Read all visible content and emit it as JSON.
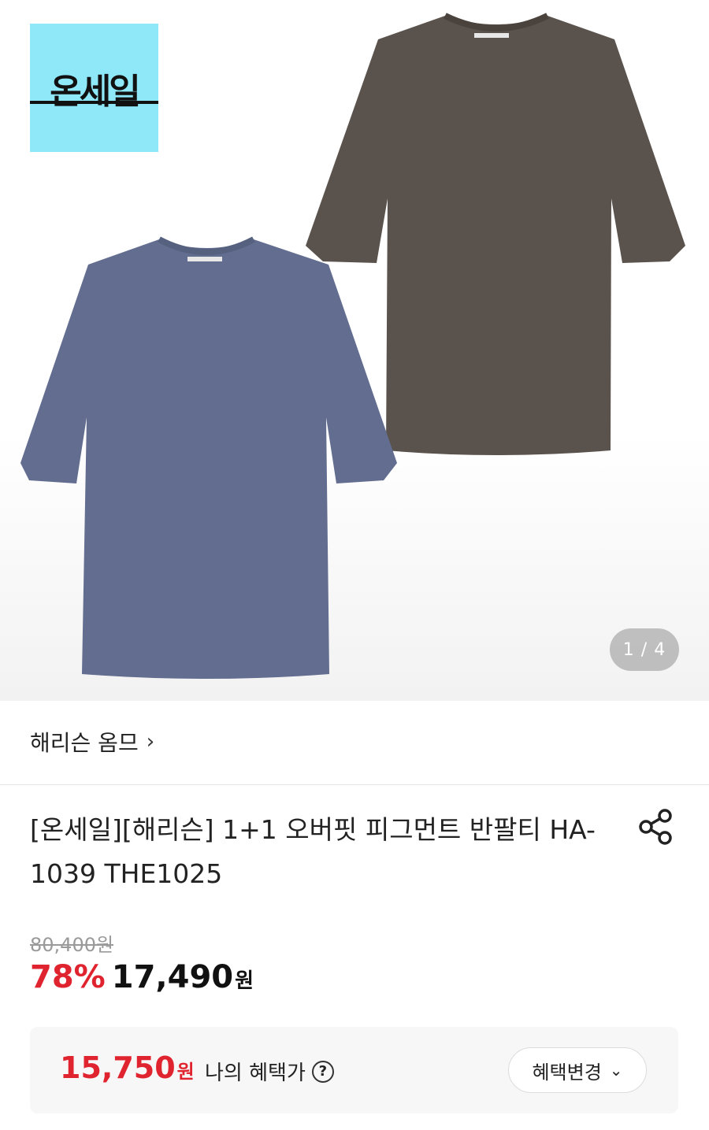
{
  "hero": {
    "badge_text": "온세일",
    "image_counter": "1 / 4",
    "colors": {
      "badge_bg": "#8ee8f8",
      "shirt_blue": "#626d8f",
      "shirt_brown": "#5a524c"
    }
  },
  "product": {
    "brand": "해리슨 옴므",
    "brand_chevron": "›",
    "title": "[온세일][해리슨] 1+1 오버핏 피그먼트 반팔티 HA-1039 THE1025",
    "original_price": "80,400원",
    "discount": "78%",
    "sale_price": "17,490",
    "sale_unit": "원"
  },
  "benefit": {
    "my_price": "15,750",
    "my_price_unit": "원",
    "label": "나의 혜택가",
    "help_icon": "?",
    "change_button": "혜택변경",
    "change_chevron": "⌄"
  },
  "accent_color": "#e0242f"
}
